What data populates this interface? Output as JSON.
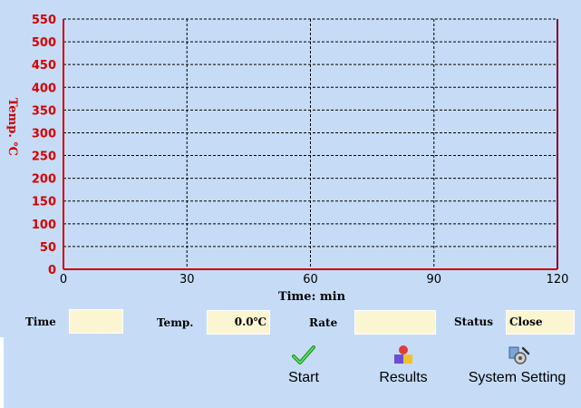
{
  "chart_data": {
    "type": "line",
    "xlabel": "Time: min",
    "ylabel": "Temp. ℃",
    "xlim": [
      0,
      120
    ],
    "ylim": [
      0,
      550
    ],
    "x_ticks": [
      0,
      30,
      60,
      90,
      120
    ],
    "y_ticks": [
      0,
      50,
      100,
      150,
      200,
      250,
      300,
      350,
      400,
      450,
      500,
      550
    ],
    "grid": true,
    "series": [],
    "colors": {
      "axis": "#cc0000",
      "tick_label": "#d40000",
      "grid": "#000000"
    }
  },
  "fields": {
    "time": {
      "label": "Time",
      "value": ""
    },
    "temp": {
      "label": "Temp.",
      "value": "0.0℃"
    },
    "rate": {
      "label": "Rate",
      "value": ""
    },
    "status": {
      "label": "Status",
      "value": "Close"
    }
  },
  "toolbar": {
    "start": {
      "label": "Start",
      "icon": "checkmark-icon"
    },
    "results": {
      "label": "Results",
      "icon": "shapes-icon"
    },
    "system_setting": {
      "label": "System Setting",
      "icon": "settings-tools-icon"
    }
  }
}
